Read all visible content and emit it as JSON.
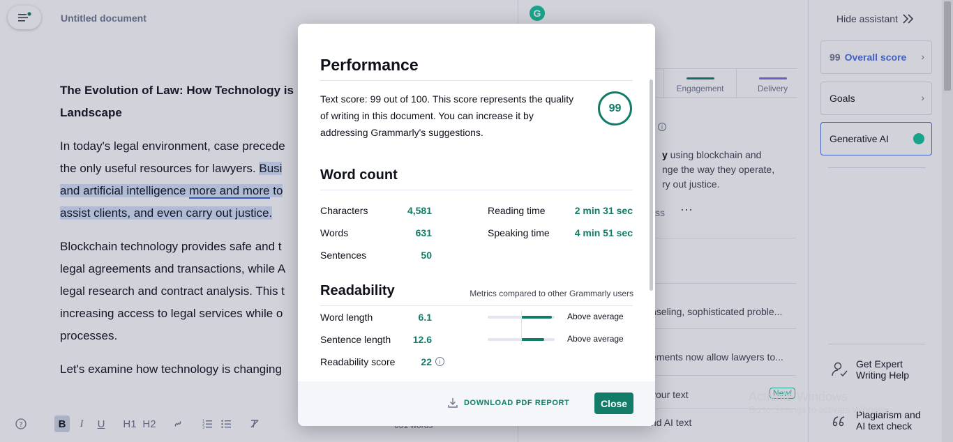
{
  "editor": {
    "doc_title": "Untitled document",
    "heading_line1": "The Evolution of Law: How Technology is",
    "heading_line2": "Landscape",
    "p1_a": "In today's legal environment, case precede",
    "p1_b": "the only useful resources for lawyers. ",
    "p1_b_hl": "Busi",
    "p1_c1": "and artificial intelligence ",
    "p1_c_ul": "more and more",
    "p1_c2": " to",
    "p1_d": "assist clients, and even carry out justice.",
    "p2_a": "Blockchain technology provides safe and t",
    "p2_b": "legal agreements and transactions, while A",
    "p2_c": "legal research and contract analysis. This t",
    "p2_d": "increasing access to legal services while o",
    "p2_e": "processes.",
    "p3_a": "Let's examine how technology is changing",
    "word_count": "631 words",
    "toolbar": {
      "bold": "B",
      "italic": "I",
      "underline": "U",
      "h1": "H1",
      "h2": "H2"
    }
  },
  "assistant": {
    "logo": "G",
    "score_peek": "9",
    "tabs": [
      {
        "label": "Engagement",
        "color": "#127c68"
      },
      {
        "label": "Delivery",
        "color": "#7b6fe0"
      }
    ],
    "card_bold": "y",
    "card_text_1": " using blockchain and",
    "card_text_2": "nge the way they operate,",
    "card_text_3": "ry out justice.",
    "dismiss": "ss",
    "more": "···",
    "row1": "nseling, sophisticated proble...",
    "row2": "ements now allow lawyers to...",
    "row3": " your text",
    "row3_badge": "New!",
    "row4": "nd AI text"
  },
  "rightbar": {
    "hide_assistant": "Hide assistant",
    "overall_score_value": "99",
    "overall_score_label": "Overall score",
    "goals": "Goals",
    "generative_ai": "Generative AI",
    "expert_line1": "Get Expert",
    "expert_line2": "Writing Help",
    "plagiarism_line1": "Plagiarism and",
    "plagiarism_line2": "AI text check"
  },
  "watermark": {
    "title": "Activate Windows",
    "subtitle": "Go to Settings to activate Windows."
  },
  "modal": {
    "performance_title": "Performance",
    "performance_text": "Text score: 99 out of 100. This score represents the quality of writing in this document. You can increase it by addressing Grammarly's suggestions.",
    "score": "99",
    "word_count_title": "Word count",
    "characters_label": "Characters",
    "characters_value": "4,581",
    "words_label": "Words",
    "words_value": "631",
    "sentences_label": "Sentences",
    "sentences_value": "50",
    "reading_time_label": "Reading time",
    "reading_time_value": "2 min 31 sec",
    "speaking_time_label": "Speaking time",
    "speaking_time_value": "4 min 51 sec",
    "readability_title": "Readability",
    "readability_note": "Metrics compared to other Grammarly users",
    "word_length_label": "Word length",
    "word_length_value": "6.1",
    "word_length_level": 0.96,
    "word_length_rating": "Above average",
    "sentence_length_label": "Sentence length",
    "sentence_length_value": "12.6",
    "sentence_length_level": 0.84,
    "sentence_length_rating": "Above average",
    "readability_score_label": "Readability score",
    "readability_score_value": "22",
    "download_label": "DOWNLOAD PDF REPORT",
    "close_label": "Close"
  },
  "colors": {
    "accent_green": "#127c68",
    "grammarly_green": "#15c39a",
    "ai_border_blue": "#4a6ee0"
  }
}
